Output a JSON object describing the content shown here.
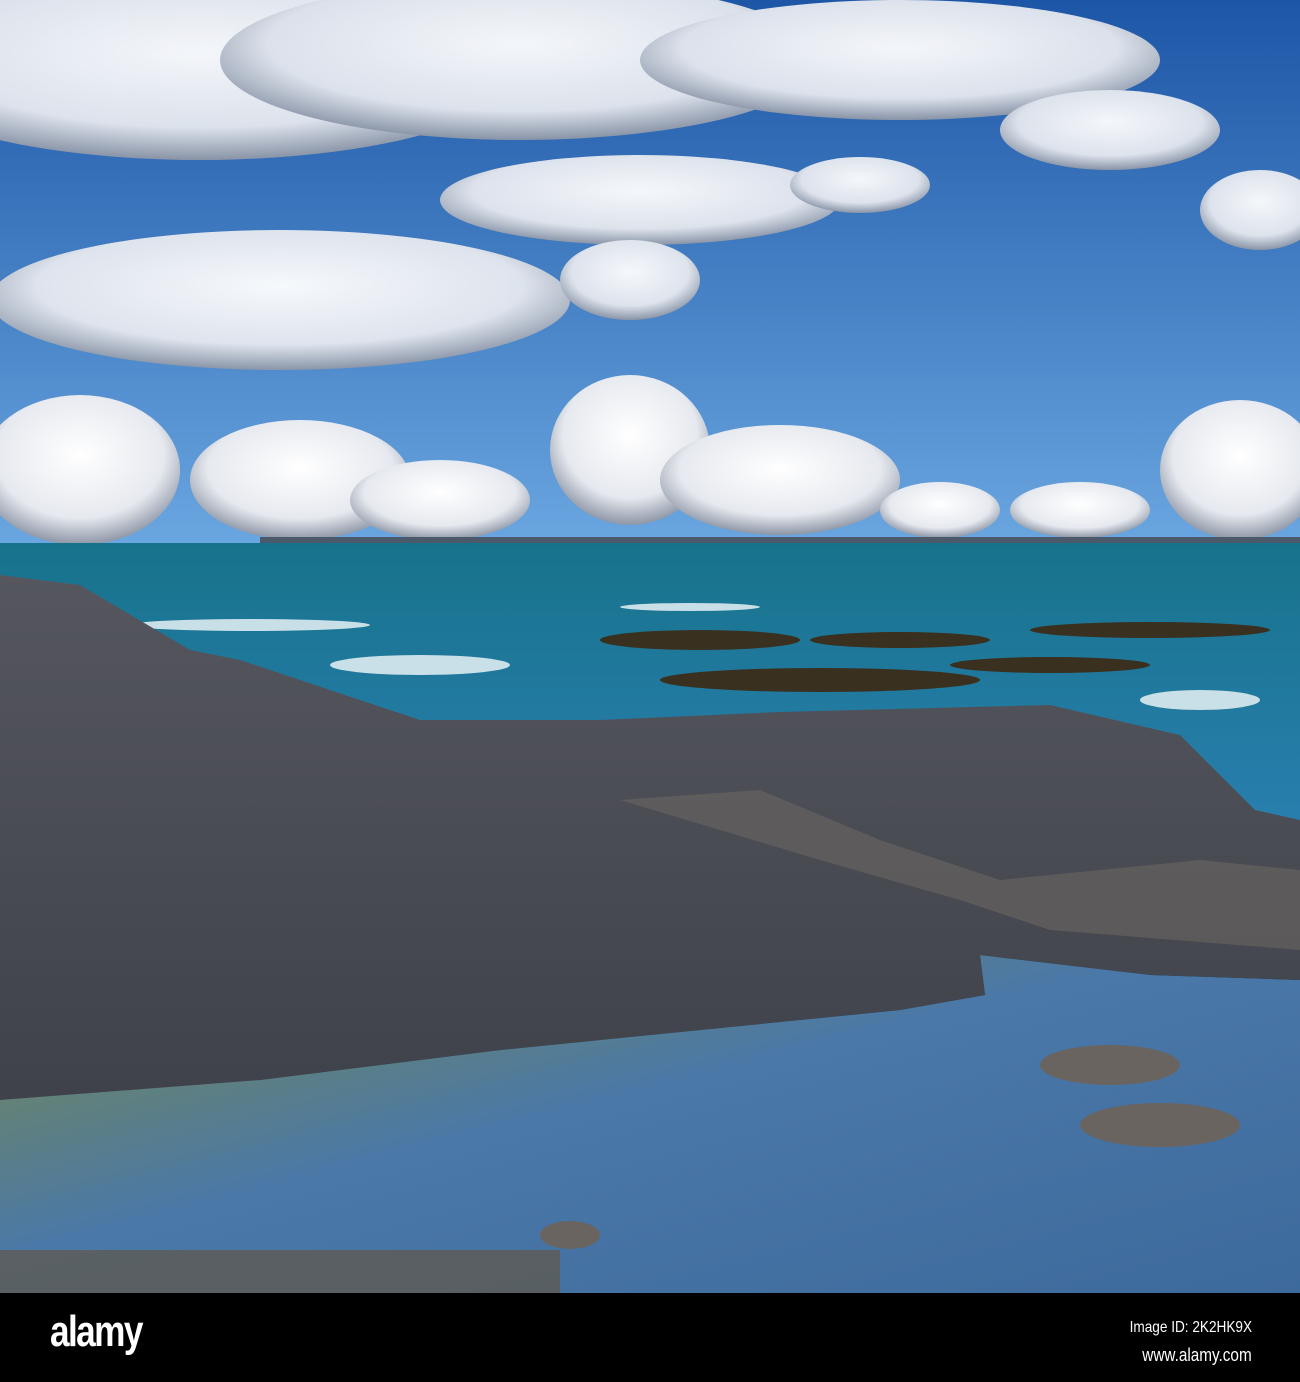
{
  "footer": {
    "logo": "alamy",
    "image_id": "Image ID: 2K2HK9X",
    "website": "www.alamy.com"
  },
  "colors": {
    "sky_top": "#1f5fae",
    "sky_horizon": "#5a9ad8",
    "sea": "#1b7f9a",
    "rock": "#4a4d55",
    "pool": "#3a6a9a"
  }
}
